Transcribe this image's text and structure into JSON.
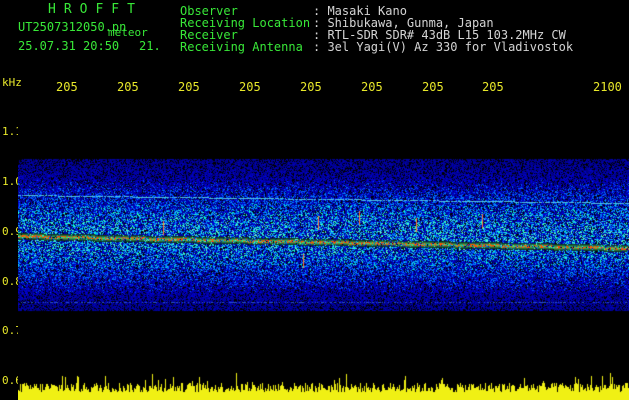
{
  "header": {
    "brand": "HROFFT",
    "file_name": "UT2507312050.pn",
    "file_suffix": "meteor",
    "datetime": "25.07.31 20:50",
    "count": "21.",
    "fields": [
      {
        "label": "Observer",
        "value": ": Masaki Kano"
      },
      {
        "label": "Receiving Location",
        "value": ": Shibukawa, Gunma, Japan"
      },
      {
        "label": "Receiver",
        "value": ": RTL-SDR SDR# 43dB L15 103.2MHz CW"
      },
      {
        "label": "Receiving Antenna",
        "value": ": 3el Yagi(V) Az 330 for Vladivostok"
      }
    ]
  },
  "axis": {
    "y_unit": "kHz",
    "x_ticks": [
      "205",
      "205",
      "205",
      "205",
      "205",
      "205",
      "205",
      "205",
      "2100"
    ],
    "y_ticks": [
      "1.1",
      "1.0",
      "0.9",
      "0.8",
      "0.7",
      "0.6"
    ]
  },
  "colors": {
    "background": "#000000",
    "text_green": "#38e838",
    "text_yellow": "#e8e82a",
    "text_grey": "#d4d4d4"
  }
}
